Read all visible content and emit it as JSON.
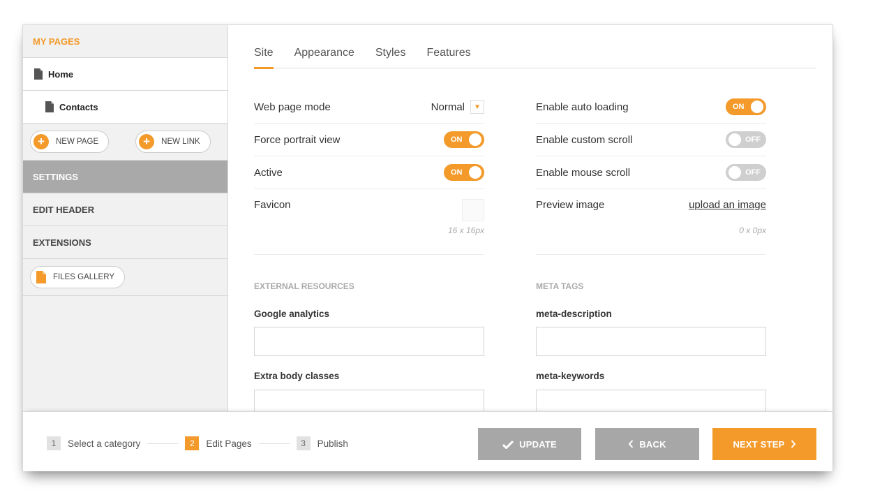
{
  "sidebar": {
    "header": "MY PAGES",
    "pages": [
      {
        "label": "Home"
      },
      {
        "label": "Contacts"
      }
    ],
    "new_page": "NEW PAGE",
    "new_link": "NEW LINK",
    "sections": [
      "SETTINGS",
      "EDIT HEADER",
      "EXTENSIONS"
    ],
    "files_gallery": "FILES GALLERY"
  },
  "tabs": [
    "Site",
    "Appearance",
    "Styles",
    "Features"
  ],
  "left_settings": {
    "web_page_mode": {
      "label": "Web page mode",
      "value": "Normal"
    },
    "force_portrait": {
      "label": "Force portrait view",
      "state": "ON"
    },
    "active": {
      "label": "Active",
      "state": "ON"
    },
    "favicon": {
      "label": "Favicon",
      "size": "16 x 16px"
    }
  },
  "right_settings": {
    "auto_loading": {
      "label": "Enable auto loading",
      "state": "ON"
    },
    "custom_scroll": {
      "label": "Enable custom scroll",
      "state": "OFF"
    },
    "mouse_scroll": {
      "label": "Enable mouse scroll",
      "state": "OFF"
    },
    "preview_image": {
      "label": "Preview image",
      "link": "upload an image",
      "size": "0 x 0px"
    }
  },
  "external_resources": {
    "title": "EXTERNAL RESOURCES",
    "google_analytics": "Google analytics",
    "extra_body_classes": "Extra body classes"
  },
  "meta_tags": {
    "title": "META TAGS",
    "description": "meta-description",
    "keywords": "meta-keywords"
  },
  "footer": {
    "steps": [
      {
        "num": "1",
        "label": "Select a category"
      },
      {
        "num": "2",
        "label": "Edit Pages"
      },
      {
        "num": "3",
        "label": "Publish"
      }
    ],
    "update": "UPDATE",
    "back": "BACK",
    "next": "NEXT STEP"
  },
  "colors": {
    "accent": "#f39a2a",
    "gray_button": "#a7a7a7",
    "sidebar_bg": "#f1f1f1"
  }
}
